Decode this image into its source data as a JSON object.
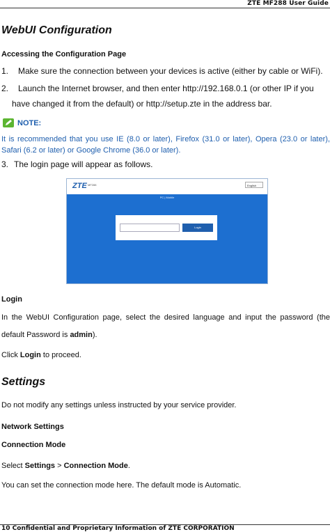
{
  "header": {
    "title": "ZTE MF288 User Guide"
  },
  "section1": {
    "title": "WebUI Configuration",
    "subtitle": "Accessing the Configuration Page",
    "steps": [
      {
        "num": "1.",
        "text": "Make sure the connection between your devices is active (either by cable or WiFi)."
      },
      {
        "num": "2.",
        "text_line1": "Launch the Internet browser, and then enter http://192.168.0.1 (or other IP if you",
        "text_line2": "have changed it from the default) or http://setup.zte in the address bar."
      },
      {
        "num": "3.",
        "text": "The login page will appear as follows."
      }
    ],
    "note": {
      "label": "NOTE:",
      "icon": "pencil-note-icon",
      "line1": "It is recommended that you use IE (8.0 or later), Firefox (31.0 or later), Opera (23.0 or later),",
      "line2": "Safari (6.2 or later) or Google Chrome (36.0 or later)."
    },
    "colors": {
      "note": "#1f5fae",
      "note_icon": "#5cb531",
      "login_bg": "#1d6fd0"
    }
  },
  "screenshot": {
    "logo": "ZTE",
    "model": "MF288",
    "language": "English",
    "mode_label": "PC | Mobile",
    "login_button": "Login"
  },
  "login": {
    "heading": "Login",
    "para_line1": "In the WebUI Configuration page, select the desired language and input the password (the",
    "para_line2_prefix": "default Password is ",
    "password": "admin",
    "para_line2_suffix": ").",
    "click_prefix": "Click ",
    "click_bold": "Login",
    "click_suffix": " to proceed."
  },
  "settings": {
    "title": "Settings",
    "warning": "Do not modify any settings unless instructed by your service provider.",
    "network_heading": "Network Settings",
    "connection_heading": "Connection Mode",
    "select_prefix": "Select ",
    "select_settings": "Settings",
    "select_sep": " > ",
    "select_mode": "Connection Mode",
    "select_suffix": ".",
    "description": "You can set the connection mode here. The default mode is Automatic."
  },
  "footer": {
    "text": "10 Confidential and Proprietary Information of ZTE CORPORATION"
  }
}
